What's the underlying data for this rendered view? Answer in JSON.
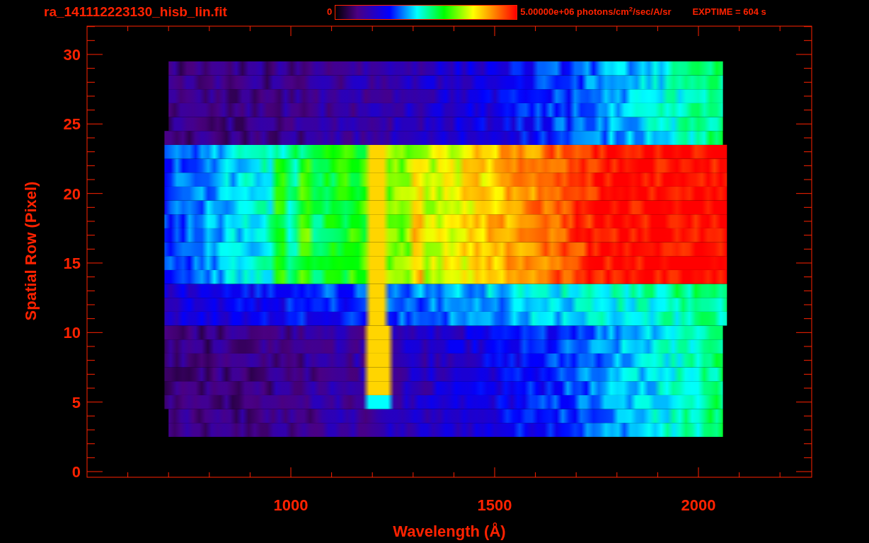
{
  "title": "ra_141112223130_hisb_lin.fit",
  "colorbar": {
    "min_label": "0",
    "max_label": "5.00000e+06 photons/cm$^{2}$/sec/A/sr"
  },
  "exposure": "EXPTIME = 604 s",
  "x_axis": {
    "title": "Wavelength (Å)",
    "tick_labels": [
      "1000",
      "1500",
      "2000"
    ]
  },
  "y_axis": {
    "title": "Spatial Row (Pixel)",
    "tick_labels": [
      "30",
      "25",
      "20",
      "15",
      "10",
      "5",
      "0"
    ]
  }
}
